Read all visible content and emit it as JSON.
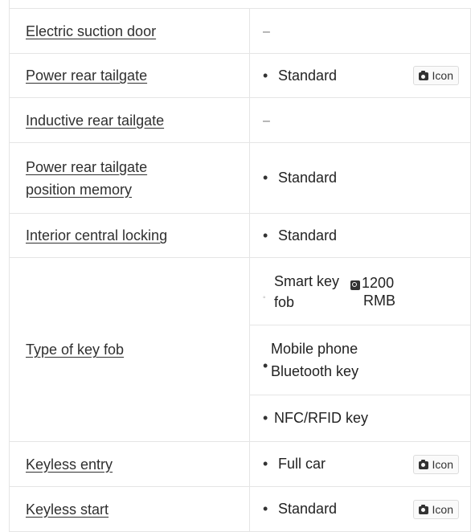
{
  "rows": [
    {
      "label": "Electric suction door",
      "value": "–"
    },
    {
      "label": "Power rear tailgate",
      "value": "Standard",
      "button": "Icon"
    },
    {
      "label": "Inductive rear tailgate",
      "value": "–"
    },
    {
      "label": "Power rear tailgate position memory",
      "label_line1": "Power rear tailgate",
      "label_line2": "position memory",
      "value": "Standard"
    },
    {
      "label": "Interior central locking",
      "value": "Standard"
    },
    {
      "label": "Type of key fob",
      "options": [
        {
          "line1": "Smart key",
          "line2": "fob",
          "price_line1": "1200",
          "price_line2": "RMB"
        },
        {
          "line1": "Mobile phone",
          "line2": "Bluetooth key"
        },
        {
          "text": "NFC/RFID key"
        }
      ]
    },
    {
      "label": "Keyless entry",
      "value": "Full car",
      "button": "Icon"
    },
    {
      "label": "Keyless start",
      "value": "Standard",
      "button": "Icon"
    }
  ],
  "bullet_glyph": "•",
  "sub_bullet_glyph": "◦",
  "icons": [
    "camera-icon",
    "price-tag-icon"
  ]
}
